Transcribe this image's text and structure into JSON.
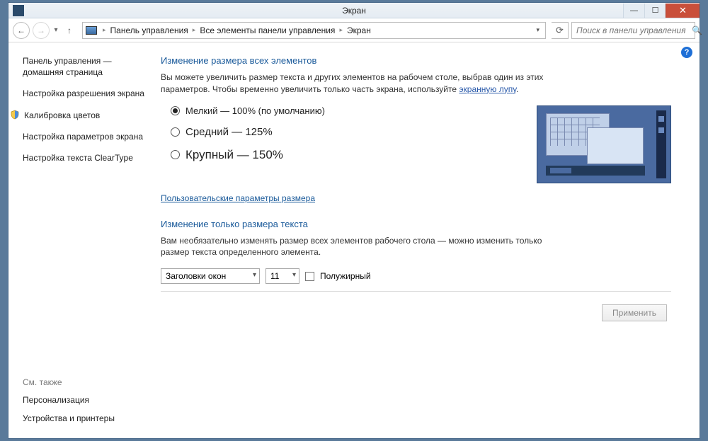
{
  "window": {
    "title": "Экран"
  },
  "nav": {
    "crumbs": [
      "Панель управления",
      "Все элементы панели управления",
      "Экран"
    ],
    "search_placeholder": "Поиск в панели управления"
  },
  "sidebar": {
    "items": [
      "Панель управления — домашняя страница",
      "Настройка разрешения экрана",
      "Калибровка цветов",
      "Настройка параметров экрана",
      "Настройка текста ClearType"
    ],
    "footer_heading": "См. также",
    "footer_links": [
      "Персонализация",
      "Устройства и принтеры"
    ]
  },
  "main": {
    "section1_title": "Изменение размера всех элементов",
    "section1_desc_a": "Вы можете увеличить размер текста и других элементов на рабочем столе, выбрав один из этих параметров. Чтобы временно увеличить только часть экрана, используйте ",
    "section1_desc_link": "экранную лупу",
    "section1_desc_b": ".",
    "size_options": [
      {
        "label": "Мелкий — 100% (по умолчанию)",
        "checked": true
      },
      {
        "label": "Средний — 125%",
        "checked": false
      },
      {
        "label": "Крупный — 150%",
        "checked": false
      }
    ],
    "custom_link": "Пользовательские параметры размера",
    "section2_title": "Изменение только размера текста",
    "section2_desc": "Вам необязательно изменять размер всех элементов рабочего стола — можно изменить только размер текста определенного элемента.",
    "element_select": "Заголовки окон",
    "size_select": "11",
    "bold_label": "Полужирный",
    "apply_label": "Применить"
  }
}
